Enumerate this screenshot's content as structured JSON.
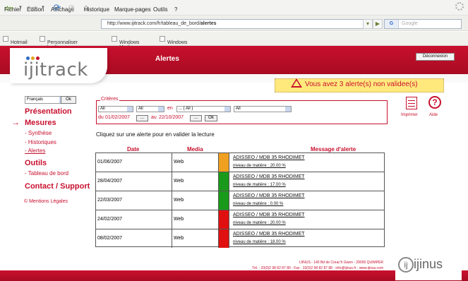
{
  "browser": {
    "menu": [
      "Fichier",
      "Édition",
      "Affichage",
      "Historique",
      "Marque-pages",
      "Outils",
      "?"
    ],
    "url_prefix": "http://www.ijitrack.com/fr/tableau_de_bord/",
    "url_page": "alertes",
    "search_placeholder": "Google",
    "search_engine": "G",
    "bookmarks": [
      "Hotmail",
      "Personnaliser les liens",
      "Windows Media",
      "Windows"
    ]
  },
  "header": {
    "logo": "ijitrack",
    "page_title": "Alertes",
    "logout_label": "Déconnexion"
  },
  "sidebar": {
    "language": "Français",
    "ok_label": "Ok",
    "presentation": "Présentation",
    "mesures": "Mesures",
    "mesures_items": [
      "- Synthèse",
      "- Historiques",
      "- Alertes"
    ],
    "outils": "Outils",
    "outils_items": [
      "- Tableau de bord"
    ],
    "contact": "Contact / Support",
    "legal": "© Mentions Légales"
  },
  "alert_banner": {
    "text": "Vous avez 3 alerte(s) non validee(s)"
  },
  "criteria": {
    "legend": "Critères",
    "select1": "All",
    "select2": "All",
    "en_label": "en",
    "select3": "... ( All )",
    "select4": "All",
    "date_from_label": "du",
    "date_from": "01/02/2007",
    "date_to_label": "au",
    "date_to": "22/10/2007",
    "ellipsis": "...",
    "ok_label": "Ok"
  },
  "tools": {
    "print_label": "Imprimer",
    "help_label": "Aide",
    "help_glyph": "?"
  },
  "instruction": "Cliquez sur une alerte pour en valider la lecture",
  "table": {
    "headers": [
      "Date",
      "Media",
      "Message d'alerte"
    ],
    "rows": [
      {
        "date": "01/06/2007",
        "media": "Web",
        "color": "#f0a020",
        "title": "ADISSEO / MDB 35 RHODIMET",
        "detail": "niveau de matière : 20.00 %"
      },
      {
        "date": "28/04/2007",
        "media": "Web",
        "color": "#1a9a1a",
        "title": "ADISSEO / MDB 35 RHODIMET",
        "detail": "niveau de matière : 17.00 %"
      },
      {
        "date": "22/03/2007",
        "media": "Web",
        "color": "#1a9a1a",
        "title": "ADISSEO / MDB 35 RHODIMET",
        "detail": "niveau de matière : 0.00 %"
      },
      {
        "date": "24/02/2007",
        "media": "Web",
        "color": "#e01010",
        "title": "ADISSEO / MDB 35 RHODIMET",
        "detail": "niveau de matière : 20.00 %"
      },
      {
        "date": "08/02/2007",
        "media": "Web",
        "color": "#e01010",
        "title": "ADISSEO / MDB 35 RHODIMET",
        "detail": "niveau de matière : 18.00 %"
      }
    ]
  },
  "footer": {
    "address": "IJINUS - 140 Bd de Creac'h Gwen - 29000 QUIMPER",
    "contact": "Tél. : 33(0)2 98 82 87 80 - Fax : 33(0)2 98 82 87 88 - info@ijinus.fr - www.ijinus.com",
    "brand": "ijinus",
    "brand_glyph": "ij"
  },
  "colors": {
    "accent": "#c8102e",
    "banner": "#ffe97d"
  }
}
